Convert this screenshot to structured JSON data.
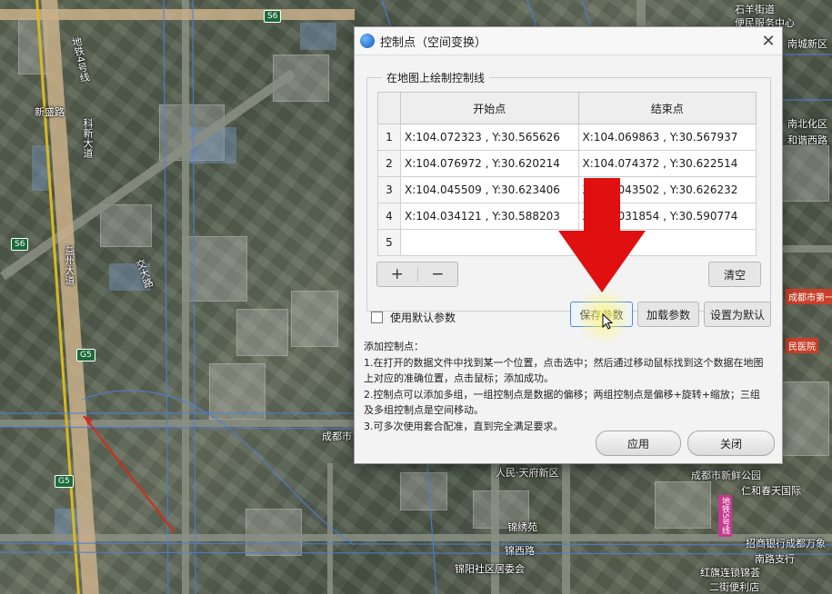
{
  "dialog": {
    "title": "控制点（空间变换）",
    "group_label": "在地图上绘制控制线",
    "columns": [
      "开始点",
      "结束点"
    ],
    "rows": [
      {
        "index": "1",
        "start": "X:104.072323 , Y:30.565626",
        "end": "X:104.069863 , Y:30.567937"
      },
      {
        "index": "2",
        "start": "X:104.076972 , Y:30.620214",
        "end": "X:104.074372 , Y:30.622514"
      },
      {
        "index": "3",
        "start": "X:104.045509 , Y:30.623406",
        "end": "X:104.043502 , Y:30.626232"
      },
      {
        "index": "4",
        "start": "X:104.034121 , Y:30.588203",
        "end": "X:104.031854 , Y:30.590774"
      },
      {
        "index": "5",
        "start": "",
        "end": ""
      }
    ],
    "add_label": "+",
    "remove_label": "−",
    "clear_label": "清空",
    "use_default_label": "使用默认参数",
    "save_params_label": "保存参数",
    "load_params_label": "加载参数",
    "set_default_label": "设置为默认",
    "help_title": "添加控制点：",
    "help_lines": [
      "1.在打开的数据文件中找到某一个位置，点击选中；然后通过移动鼠标找到这个数据在地图",
      "上对应的准确位置，点击鼠标；添加成功。",
      "2.控制点可以添加多组，一组控制点是数据的偏移；两组控制点是偏移+旋转+缩放；三组",
      "及多组控制点是空间移动。",
      "3.可多次使用套合配准，直到完全满足要求。"
    ],
    "apply_label": "应用",
    "close_label": "关闭"
  },
  "map": {
    "labels": {
      "metro4": "地铁4号线",
      "xinsheng": "新盛路",
      "yiwei": "益州大道",
      "kejian": "科新大道",
      "jiaoda": "交大路",
      "s6a": "S6",
      "s6b": "S6",
      "g5a": "G5",
      "g5b": "G5",
      "chengdu": "成都市",
      "renmin": "人民·天府新区",
      "jinxiu": "锦西路",
      "jinyang": "锦阳社区居委会",
      "shibei": "石羊街道",
      "service": "便民服务中心",
      "nanxin": "南城新区",
      "nanbei": "南北化区",
      "hexie": "和谐西路",
      "chengdu1": "成都市第一",
      "minyi": "民医院",
      "metro5": "地铁5号线",
      "zhaoshang": "招商银行成都万象",
      "nanlu": "南路支行",
      "hongqi": "红旗连锁锦荟",
      "ershi": "二街便利店",
      "renhe": "仁和春天国际",
      "gongyuan": "成都市新鲜公园",
      "jinxiu2": "锦绣苑"
    }
  },
  "colors": {
    "arrow": "#e01010",
    "line": "#d42a1a",
    "highlight": "#fff36a"
  }
}
